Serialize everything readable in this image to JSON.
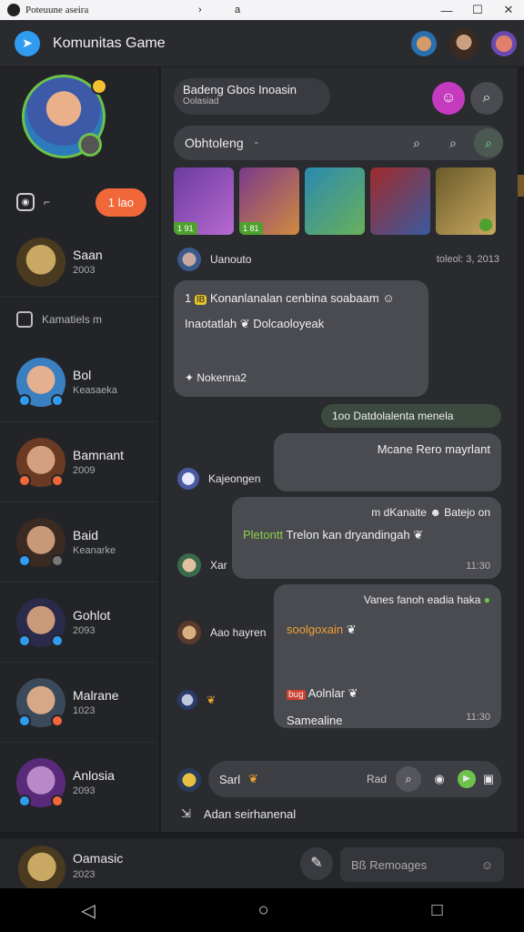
{
  "window": {
    "title": "Poteuune aseira",
    "address": "a",
    "controls": {
      "minimize": "—",
      "maximize": "☐",
      "close": "✕"
    },
    "back_arrow": "›"
  },
  "app": {
    "title": "Komunitas Game",
    "accent": "#2f9cf0"
  },
  "sidebar": {
    "status_dash": "⌐",
    "status_pill": "1 lao",
    "pinned": {
      "name": "Saan",
      "sub": "2003"
    },
    "section_label": "Kamatiels m",
    "contacts": [
      {
        "name": "Bol",
        "sub": "Keasaeka"
      },
      {
        "name": "Bamnant",
        "sub": "2009"
      },
      {
        "name": "Baid",
        "sub": "Keanarke"
      },
      {
        "name": "Gohlot",
        "sub": "2093"
      },
      {
        "name": "Malrane",
        "sub": "1023"
      },
      {
        "name": "Anlosia",
        "sub": "2093"
      }
    ]
  },
  "chat": {
    "header_title": "Badeng Gbos Inoasin",
    "header_sub": "Oolasiad",
    "search_placeholder": "Obhtoleng",
    "search_hint": "⁃",
    "thumb_tags": [
      "1 91",
      "1 81"
    ],
    "first_sender": "Uanouto",
    "first_time": "toleol: 3, 2013",
    "bubble1": {
      "badge": "1",
      "badge2": "IB",
      "line1": "Konanlanalan cenbina soabaam",
      "line2a": "Inaotatlah",
      "line2b": "Dolcaoloyeak",
      "footer": "Nokenna2"
    },
    "green_bar": "1oo Datdolalenta menela",
    "bubble2": {
      "text": "Mcane Rero mayrlant",
      "sender": "Kajeongen"
    },
    "bubble3": {
      "top": "m dKanaite",
      "top2": "Batejo on",
      "highlight": "Pletontt",
      "text": "Trelon kan dryandingah",
      "time": "11:30",
      "sender": "Xar"
    },
    "bubble4": {
      "top": "Vanes fanoh eadia haka",
      "orange": "soolgoxain",
      "tag": "bug",
      "text": "Aolnlar",
      "last": "Samealine",
      "time": "11:30",
      "sender": "Aao hayren"
    },
    "composer": {
      "text": "Sarl",
      "label": "Rad"
    },
    "bottom_note": "Adan seirhanenal"
  },
  "bottom": {
    "name": "Oamasic",
    "sub": "2023",
    "input_placeholder": "Bß Remoages"
  },
  "colors": {
    "bg": "#1c1d20",
    "panel": "#2a2b2f",
    "bubble": "#4a4b50",
    "green": "#6cc24a",
    "orange": "#f0683a",
    "purple": "#c43bbf"
  }
}
